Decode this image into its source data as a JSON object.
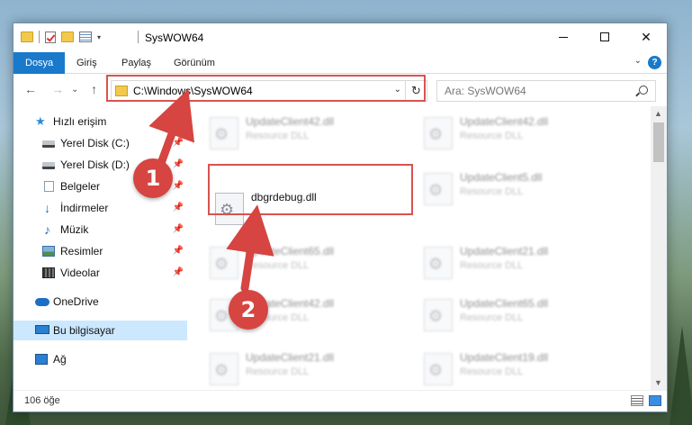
{
  "window": {
    "title": "SysWOW64",
    "controls": {
      "minimize": "—",
      "maximize": "☐",
      "close": "✕"
    }
  },
  "ribbon": {
    "tabs": [
      "Dosya",
      "Giriş",
      "Paylaş",
      "Görünüm"
    ],
    "help": "?"
  },
  "address_bar": {
    "path": "C:\\Windows\\SysWOW64",
    "refresh_glyph": "↻"
  },
  "search": {
    "placeholder": "Ara: SysWOW64"
  },
  "nav": {
    "back": "←",
    "forward": "→",
    "up": "↑",
    "recent": "⌄"
  },
  "sidebar": {
    "items": [
      {
        "label": "Hızlı erişim",
        "icon": "star-icon",
        "pinned": false
      },
      {
        "label": "Yerel Disk (C:)",
        "icon": "drive-icon",
        "pinned": true
      },
      {
        "label": "Yerel Disk (D:)",
        "icon": "drive-icon",
        "pinned": true
      },
      {
        "label": "Belgeler",
        "icon": "documents-icon",
        "pinned": true
      },
      {
        "label": "İndirmeler",
        "icon": "downloads-icon",
        "pinned": true
      },
      {
        "label": "Müzik",
        "icon": "music-icon",
        "pinned": true
      },
      {
        "label": "Resimler",
        "icon": "pictures-icon",
        "pinned": true
      },
      {
        "label": "Videolar",
        "icon": "videos-icon",
        "pinned": true
      },
      {
        "label": "OneDrive",
        "icon": "onedrive-icon",
        "pinned": false
      },
      {
        "label": "Bu bilgisayar",
        "icon": "this-pc-icon",
        "pinned": false,
        "selected": true
      },
      {
        "label": "Ağ",
        "icon": "network-icon",
        "pinned": false
      }
    ]
  },
  "files": {
    "left": [
      {
        "name": "UpdateClient42.dll",
        "type": "Resource DLL",
        "blurred": true
      },
      {
        "name": "dbgrdebug.dll",
        "type": "",
        "blurred": false,
        "highlighted": true
      },
      {
        "name": "UpdateClient65.dll",
        "type": "Resource DLL",
        "blurred": true
      },
      {
        "name": "UpdateClient42.dll",
        "type": "Resource DLL",
        "blurred": true
      },
      {
        "name": "UpdateClient21.dll",
        "type": "Resource DLL",
        "blurred": true
      }
    ],
    "right": [
      {
        "name": "UpdateClient42.dll",
        "type": "Resource DLL",
        "blurred": true
      },
      {
        "name": "UpdateClient5.dll",
        "type": "Resource DLL",
        "blurred": true
      },
      {
        "name": "UpdateClient21.dll",
        "type": "Resource DLL",
        "blurred": true
      },
      {
        "name": "UpdateClient65.dll",
        "type": "Resource DLL",
        "blurred": true
      },
      {
        "name": "UpdateClient19.dll",
        "type": "Resource DLL",
        "blurred": true
      }
    ]
  },
  "status": {
    "item_count": "106 öğe"
  },
  "callouts": {
    "step1": "1",
    "step2": "2"
  },
  "colors": {
    "accent": "#1979ca",
    "selection": "#cce8ff",
    "callout_red": "#d64541",
    "highlight_red": "#d9534f"
  }
}
